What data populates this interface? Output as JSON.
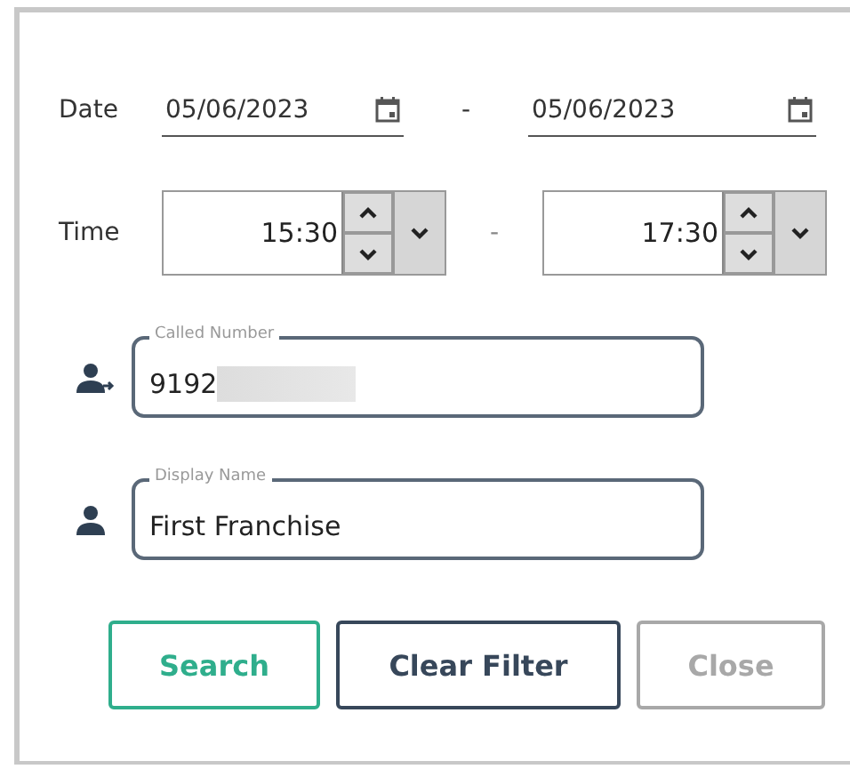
{
  "date": {
    "label": "Date",
    "separator": "-",
    "from": "05/06/2023",
    "to": "05/06/2023"
  },
  "time": {
    "label": "Time",
    "separator": "-",
    "from": "15:30",
    "to": "17:30"
  },
  "fields": [
    {
      "kind": "called",
      "label": "Called Number",
      "value": "9192",
      "redacted": true
    },
    {
      "kind": "person",
      "label": "Display Name",
      "value": "First Franchise",
      "redacted": false
    }
  ],
  "buttons": [
    {
      "label": "Search",
      "kind": "primary",
      "disabled": false
    },
    {
      "label": "Clear Filter",
      "kind": "secondary",
      "disabled": false
    },
    {
      "label": "Close",
      "kind": "secondary",
      "disabled": true
    }
  ]
}
